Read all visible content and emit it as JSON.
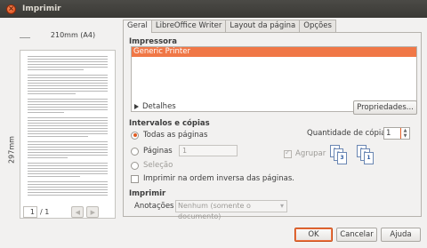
{
  "window": {
    "title": "Imprimir"
  },
  "preview": {
    "page_size": "210mm (A4)",
    "page_height": "297mm",
    "current_page": "1",
    "total_pages": "/ 1"
  },
  "tabs": [
    {
      "label": "Geral"
    },
    {
      "label": "LibreOffice Writer"
    },
    {
      "label": "Layout da página"
    },
    {
      "label": "Opções"
    }
  ],
  "printer": {
    "section_title": "Impressora",
    "selected": "Generic Printer",
    "details_label": "Detalhes",
    "properties_button": "Propriedades..."
  },
  "ranges": {
    "section_title": "Intervalos e cópias",
    "all_pages": "Todas as páginas",
    "pages": "Páginas",
    "pages_value": "1",
    "selection": "Seleção",
    "reverse_order": "Imprimir na ordem inversa das páginas.",
    "copies_label": "Quantidade de cópias",
    "copies_value": "1",
    "collate": "Agrupar"
  },
  "print": {
    "section_title": "Imprimir",
    "annotations_label": "Anotações",
    "annotations_value": "Nenhum (somente o documento)"
  },
  "buttons": {
    "ok": "OK",
    "cancel": "Cancelar",
    "help": "Ajuda"
  },
  "colors": {
    "accent": "#f07746",
    "titlebar": "#3c3b37"
  }
}
